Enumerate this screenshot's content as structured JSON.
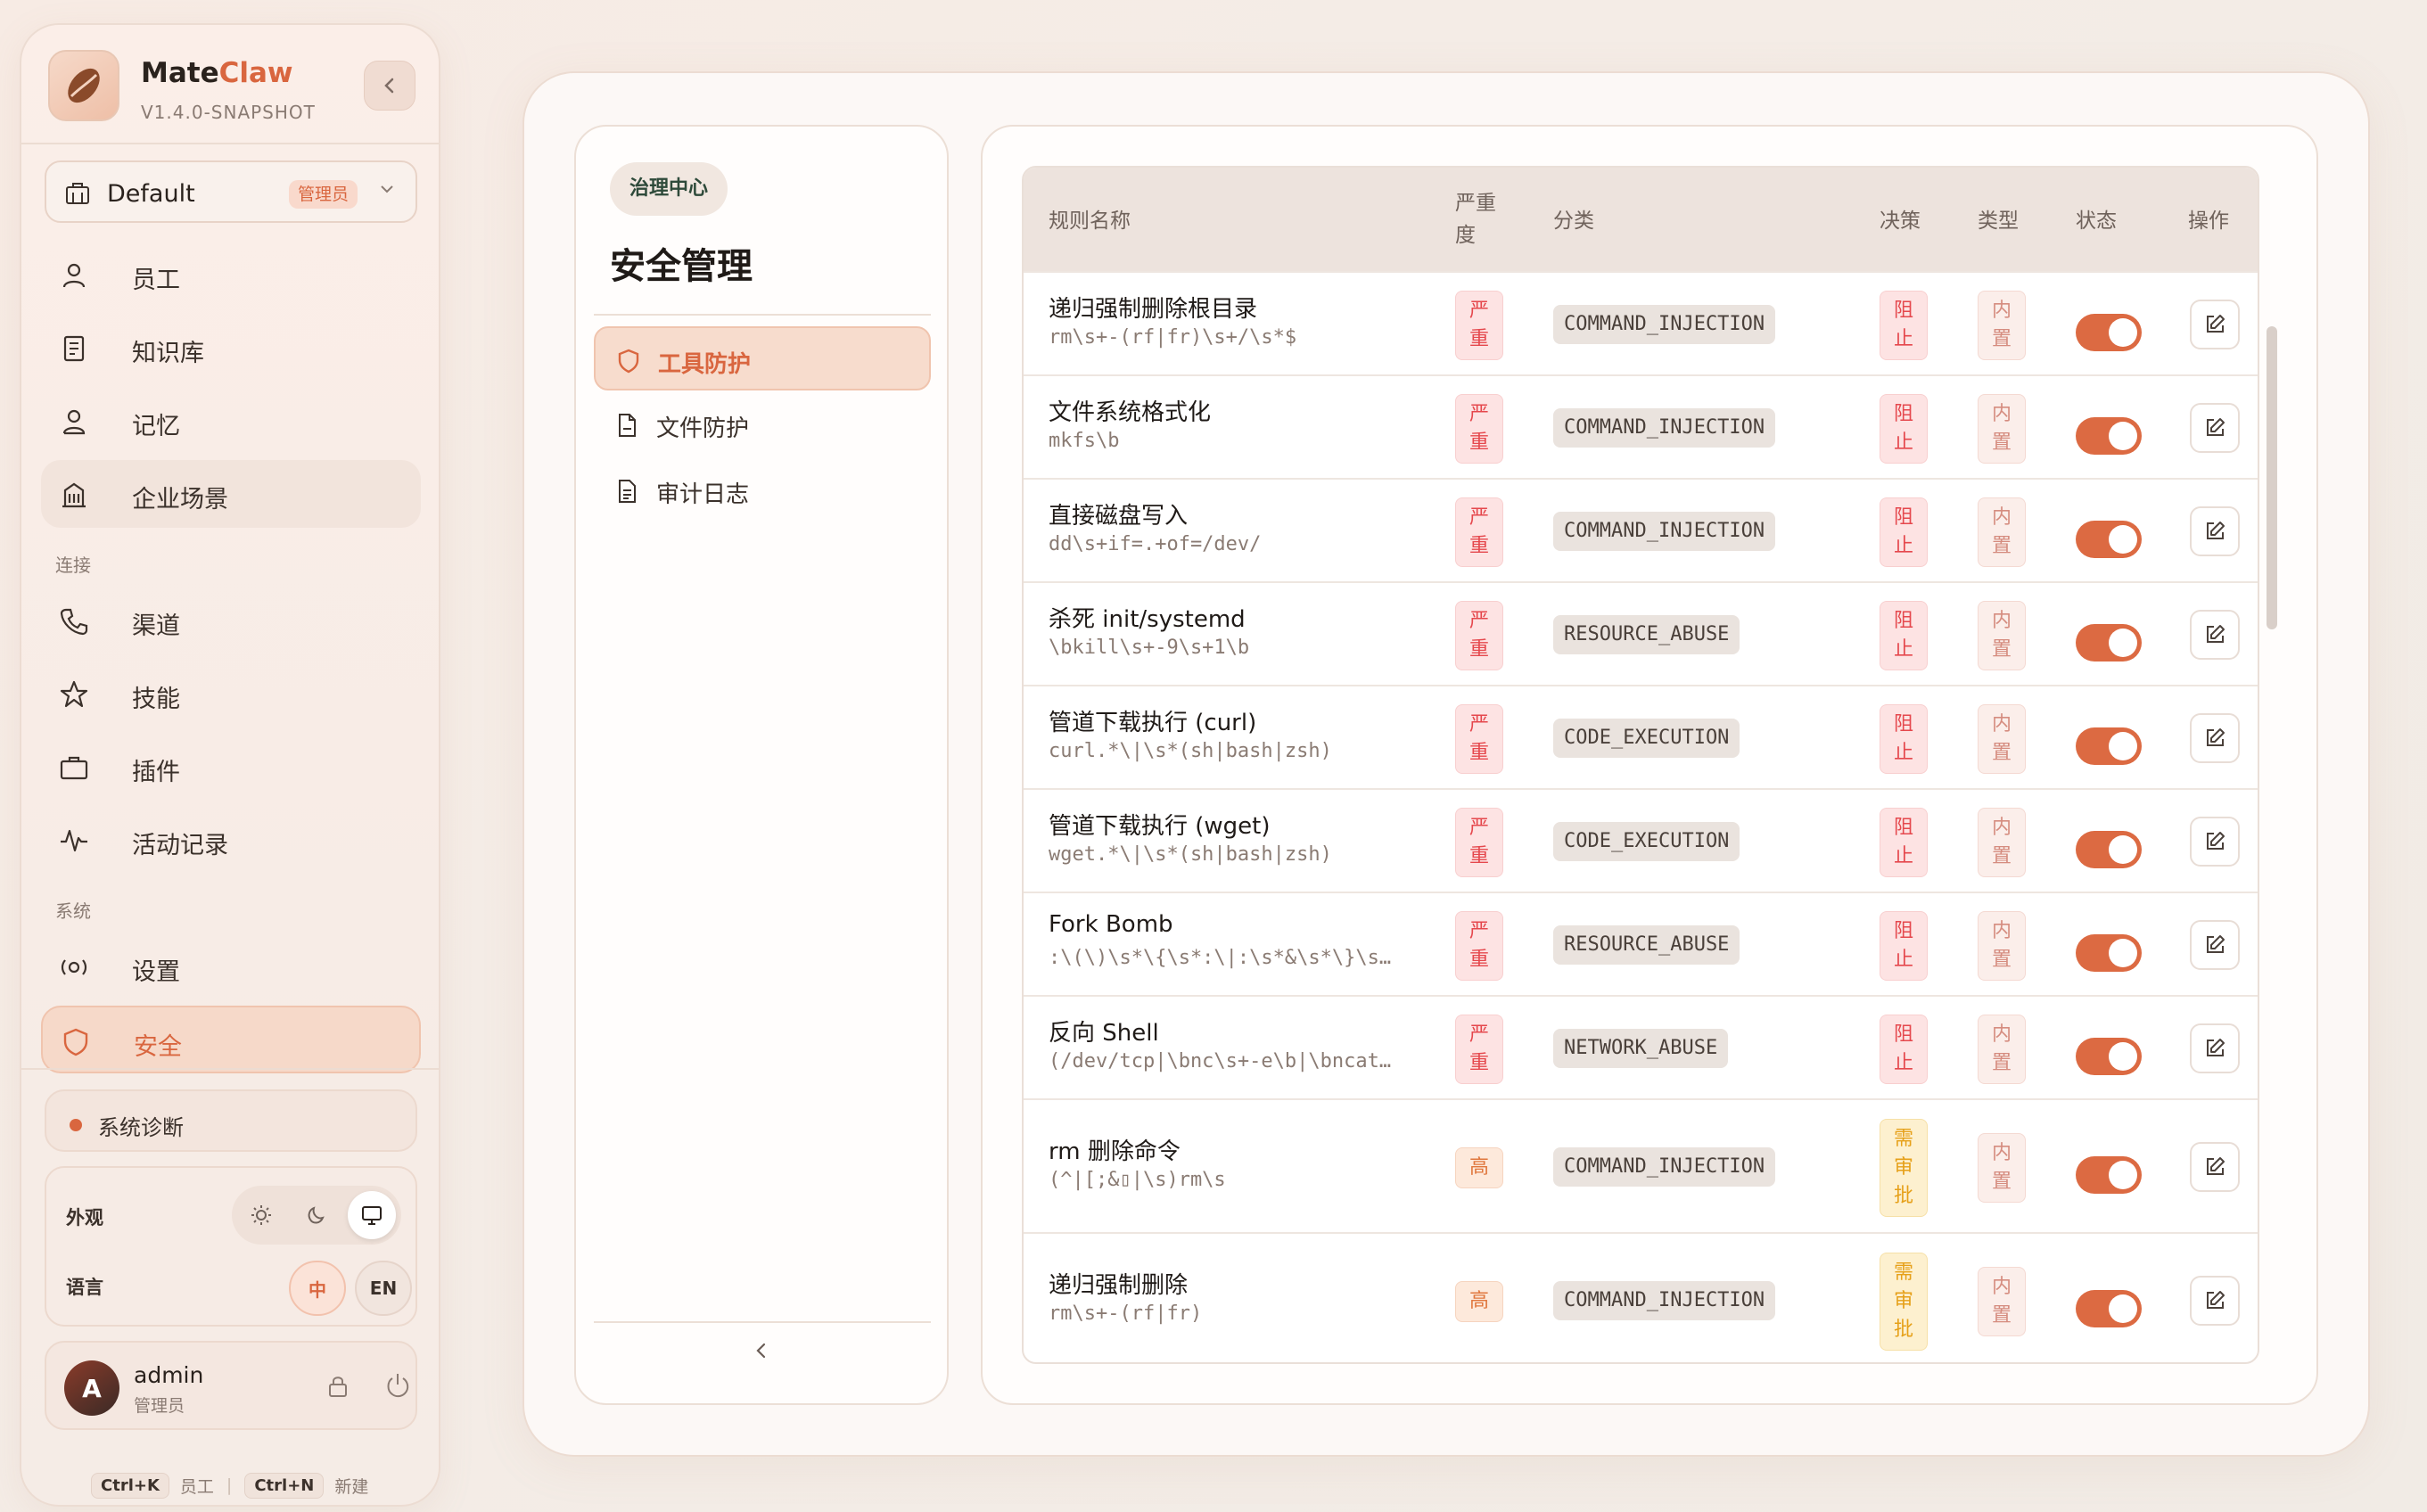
{
  "app": {
    "name_main": "Mate",
    "name_accent": "Claw",
    "version": "V1.4.0-SNAPSHOT",
    "collapse_icon": "chevron-left-icon"
  },
  "workspace": {
    "name": "Default",
    "badge": "管理员"
  },
  "nav": {
    "items_top": [
      {
        "label": "员工",
        "icon": "user-icon"
      },
      {
        "label": "知识库",
        "icon": "book-icon"
      },
      {
        "label": "记忆",
        "icon": "person-icon"
      },
      {
        "label": "企业场景",
        "icon": "building-icon"
      }
    ],
    "section_connect": "连接",
    "items_connect": [
      {
        "label": "渠道",
        "icon": "phone-icon"
      },
      {
        "label": "技能",
        "icon": "star-icon"
      },
      {
        "label": "插件",
        "icon": "briefcase-icon"
      },
      {
        "label": "活动记录",
        "icon": "activity-icon"
      }
    ],
    "section_system": "系统",
    "items_system": [
      {
        "label": "设置",
        "icon": "settings-icon"
      },
      {
        "label": "安全",
        "icon": "shield-icon"
      }
    ]
  },
  "diagnostics": {
    "label": "系统诊断"
  },
  "prefs": {
    "appearance_label": "外观",
    "language_label": "语言",
    "lang_zh": "中",
    "lang_en": "EN",
    "theme_selected": "system"
  },
  "user": {
    "initial": "A",
    "name": "admin",
    "role": "管理员"
  },
  "shortcuts": {
    "k_key": "Ctrl+K",
    "k_label": "员工",
    "n_key": "Ctrl+N",
    "n_label": "新建"
  },
  "subnav": {
    "chip": "治理中心",
    "title": "安全管理",
    "items": [
      {
        "label": "工具防护",
        "icon": "shield-icon"
      },
      {
        "label": "文件防护",
        "icon": "file-icon"
      },
      {
        "label": "审计日志",
        "icon": "document-icon"
      }
    ],
    "collapse_icon": "chevron-left-icon"
  },
  "table": {
    "headers": {
      "name": "规则名称",
      "severity_1": "严重",
      "severity_2": "度",
      "category": "分类",
      "decision": "决策",
      "type": "类型",
      "status": "状态",
      "actions": "操作"
    },
    "rows": [
      {
        "name": "递归强制删除根目录",
        "pattern": "rm\\s+-(rf|fr)\\s+/\\s*$",
        "severity": [
          "严",
          "重"
        ],
        "category": "COMMAND_INJECTION",
        "decision": [
          "阻",
          "止"
        ],
        "type": [
          "内",
          "置"
        ],
        "enabled": true
      },
      {
        "name": "文件系统格式化",
        "pattern": "mkfs\\b",
        "severity": [
          "严",
          "重"
        ],
        "category": "COMMAND_INJECTION",
        "decision": [
          "阻",
          "止"
        ],
        "type": [
          "内",
          "置"
        ],
        "enabled": true
      },
      {
        "name": "直接磁盘写入",
        "pattern": "dd\\s+if=.+of=/dev/",
        "severity": [
          "严",
          "重"
        ],
        "category": "COMMAND_INJECTION",
        "decision": [
          "阻",
          "止"
        ],
        "type": [
          "内",
          "置"
        ],
        "enabled": true
      },
      {
        "name": "杀死 init/systemd",
        "pattern": "\\bkill\\s+-9\\s+1\\b",
        "severity": [
          "严",
          "重"
        ],
        "category": "RESOURCE_ABUSE",
        "decision": [
          "阻",
          "止"
        ],
        "type": [
          "内",
          "置"
        ],
        "enabled": true
      },
      {
        "name": "管道下载执行 (curl)",
        "pattern": "curl.*\\|\\s*(sh|bash|zsh)",
        "severity": [
          "严",
          "重"
        ],
        "category": "CODE_EXECUTION",
        "decision": [
          "阻",
          "止"
        ],
        "type": [
          "内",
          "置"
        ],
        "enabled": true
      },
      {
        "name": "管道下载执行 (wget)",
        "pattern": "wget.*\\|\\s*(sh|bash|zsh)",
        "severity": [
          "严",
          "重"
        ],
        "category": "CODE_EXECUTION",
        "decision": [
          "阻",
          "止"
        ],
        "type": [
          "内",
          "置"
        ],
        "enabled": true
      },
      {
        "name": "Fork Bomb",
        "pattern": ":\\(\\)\\s*\\{\\s*:\\|:\\s*&\\s*\\}\\s…",
        "severity": [
          "严",
          "重"
        ],
        "category": "RESOURCE_ABUSE",
        "decision": [
          "阻",
          "止"
        ],
        "type": [
          "内",
          "置"
        ],
        "enabled": true
      },
      {
        "name": "反向 Shell",
        "pattern": "(/dev/tcp|\\bnc\\s+-e\\b|\\bncat…",
        "severity": [
          "严",
          "重"
        ],
        "category": "NETWORK_ABUSE",
        "decision": [
          "阻",
          "止"
        ],
        "type": [
          "内",
          "置"
        ],
        "enabled": true
      },
      {
        "name": "rm 删除命令",
        "pattern": "(^|[;&▯|\\s)rm\\s",
        "severity": [
          "高"
        ],
        "category": "COMMAND_INJECTION",
        "decision": [
          "需",
          "审",
          "批"
        ],
        "type": [
          "内",
          "置"
        ],
        "enabled": true
      },
      {
        "name": "递归强制删除",
        "pattern": "rm\\s+-(rf|fr)",
        "severity": [
          "高"
        ],
        "category": "COMMAND_INJECTION",
        "decision": [
          "需",
          "审",
          "批"
        ],
        "type": [
          "内",
          "置"
        ],
        "enabled": true
      }
    ]
  },
  "colors": {
    "accent": "#d9663f",
    "danger": "#e5484d",
    "warning": "#e6a019"
  }
}
